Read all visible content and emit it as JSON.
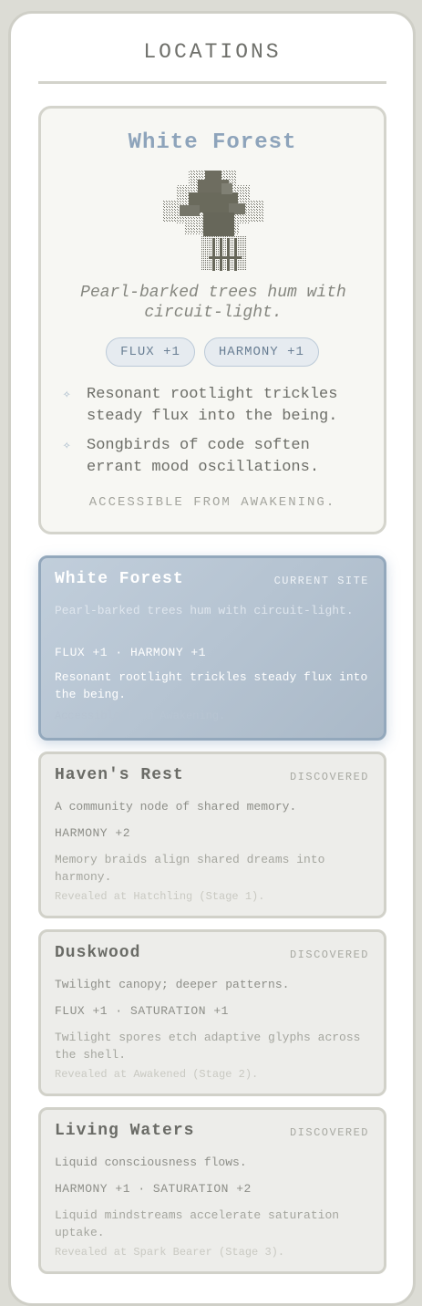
{
  "header": {
    "title": "LOCATIONS"
  },
  "featured": {
    "name": "White Forest",
    "description": "Pearl-barked trees hum with circuit-light.",
    "badges": [
      "FLUX +1",
      "HARMONY +1"
    ],
    "bullets": [
      "Resonant rootlight trickles steady flux into the being.",
      "Songbirds of code soften errant mood oscillations."
    ],
    "access": "ACCESSIBLE FROM AWAKENING.",
    "sprite_icon": "pixel-creature-icon"
  },
  "locations": [
    {
      "name": "White Forest",
      "status": "CURRENT SITE",
      "description": "Pearl-barked trees hum with circuit-light.",
      "stats": "FLUX +1 · HARMONY +1",
      "note": "Resonant rootlight trickles steady flux into the being.",
      "reveal": "Accessible from Awakening."
    },
    {
      "name": "Haven's Rest",
      "status": "DISCOVERED",
      "description": "A community node of shared memory.",
      "stats": "HARMONY +2",
      "note": "Memory braids align shared dreams into harmony.",
      "reveal": "Revealed at Hatchling (Stage 1)."
    },
    {
      "name": "Duskwood",
      "status": "DISCOVERED",
      "description": "Twilight canopy; deeper patterns.",
      "stats": "FLUX +1 · SATURATION +1",
      "note": "Twilight spores etch adaptive glyphs across the shell.",
      "reveal": "Revealed at Awakened (Stage 2)."
    },
    {
      "name": "Living Waters",
      "status": "DISCOVERED",
      "description": "Liquid consciousness flows.",
      "stats": "HARMONY +1 · SATURATION +2",
      "note": "Liquid mindstreams accelerate saturation uptake.",
      "reveal": "Revealed at Spark Bearer (Stage 3)."
    }
  ],
  "colors": {
    "accent": "#8ea4bb",
    "current_card": "#aab9c8",
    "card_bg": "#ededea"
  }
}
